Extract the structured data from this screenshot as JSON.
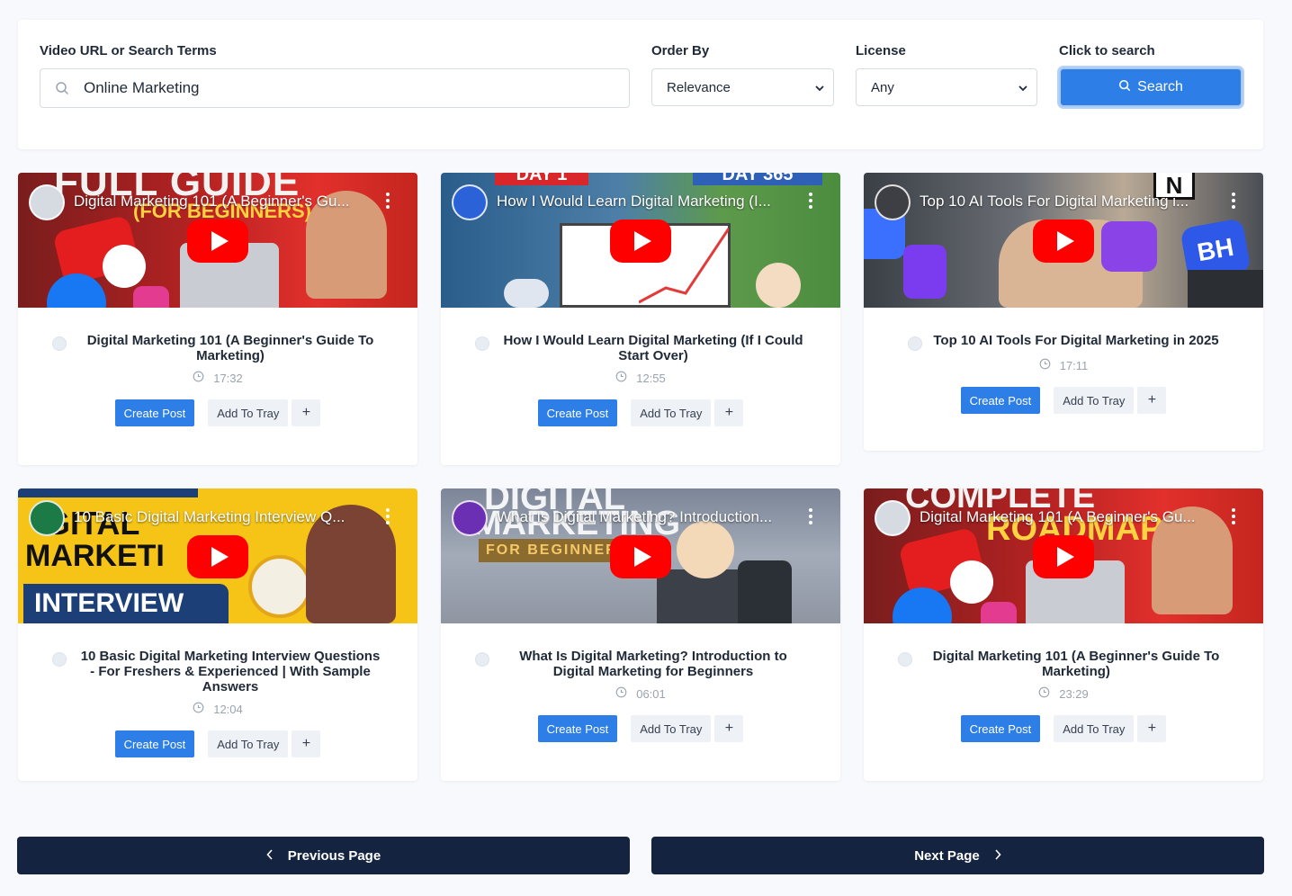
{
  "search": {
    "query_label": "Video URL or Search Terms",
    "query_value": "Online Marketing",
    "order_label": "Order By",
    "order_value": "Relevance",
    "license_label": "License",
    "license_value": "Any",
    "click_label": "Click to search",
    "button_label": "Search"
  },
  "card_actions": {
    "create": "Create Post",
    "tray": "Add To Tray",
    "plus": "+"
  },
  "videos": [
    {
      "overlay": "Digital Marketing 101 (A Beginner's Gu...",
      "title": "Digital Marketing 101 (A Beginner's Guide To Marketing)",
      "duration": "17:32"
    },
    {
      "overlay": "How I Would Learn Digital Marketing (I...",
      "title": "How I Would Learn Digital Marketing (If I Could Start Over)",
      "duration": "12:55"
    },
    {
      "overlay": "Top 10 AI Tools For Digital Marketing i...",
      "title": "Top 10 AI Tools For Digital Marketing in 2025",
      "duration": "17:11"
    },
    {
      "overlay": "10 Basic Digital Marketing Interview Q...",
      "title": "10 Basic Digital Marketing Interview Questions - For Freshers & Experienced | With Sample Answers",
      "duration": "12:04"
    },
    {
      "overlay": "What Is Digital Marketing? Introduction...",
      "title": "What Is Digital Marketing? Introduction to Digital Marketing for Beginners",
      "duration": "06:01"
    },
    {
      "overlay": "Digital Marketing 101 (A Beginner's Gu...",
      "title": "Digital Marketing 101 (A Beginner's Guide To Marketing)",
      "duration": "23:29"
    }
  ],
  "thumb_text": {
    "t0a": "FULL GUIDE",
    "t0b": "(FOR BEGINNERS)",
    "t1a": "DAY 1",
    "t1b": "DAY 365",
    "t2a": "BH",
    "t2b": "N",
    "t3a": "GITAL",
    "t3b": "MARKETI",
    "t3c": "INTERVIEW",
    "t4a": "DIGITAL",
    "t4b": "MARKETING",
    "t4c": "FOR BEGINNERS",
    "t5a": "COMPLETE",
    "t5b": "ROADMAP"
  },
  "pager": {
    "prev": "Previous Page",
    "next": "Next Page"
  },
  "colors": {
    "primary": "#2d7ee6",
    "navy": "#14233f",
    "youtube_red": "#ff0000"
  }
}
